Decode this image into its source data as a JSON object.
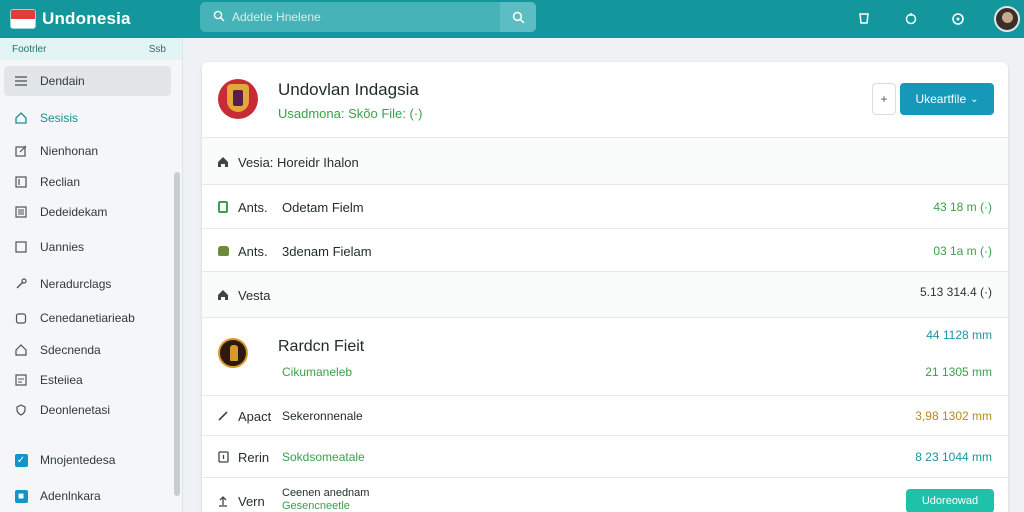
{
  "app": {
    "brand": "Undonesia",
    "search_placeholder": "Addetie Hnelene"
  },
  "colors": {
    "topbar": "#14979c",
    "accent_green": "#3aa04a",
    "accent_blue": "#1698b9",
    "chip": "#1ec2a8"
  },
  "topbar_icons": [
    "search-icon",
    "shield-icon",
    "bell-icon",
    "info-icon",
    "user-avatar"
  ],
  "sidebar": {
    "header_left": "Footrler",
    "header_right": "Ssb",
    "items": [
      {
        "label": "Dendain",
        "icon": "menu-icon"
      },
      {
        "label": "Sesisis",
        "icon": "home-icon"
      },
      {
        "label": "Nienhonan",
        "icon": "edit-icon"
      },
      {
        "label": "Reclian",
        "icon": "note-icon"
      },
      {
        "label": "Dedeidekam",
        "icon": "list-icon"
      },
      {
        "label": "Uannies",
        "icon": "square-icon"
      },
      {
        "label": "Neradurclags",
        "icon": "wrench-icon"
      },
      {
        "label": "Cenedanetiarieab",
        "icon": "clipboard-icon"
      },
      {
        "label": "Sdecnenda",
        "icon": "home-icon"
      },
      {
        "label": "Esteiiea",
        "icon": "doc-icon"
      },
      {
        "label": "Deonlenetasi",
        "icon": "shield-icon"
      },
      {
        "label": "Mnojentedesa",
        "icon": "checkbox-icon"
      },
      {
        "label": "Adenlnkara",
        "icon": "checkbox-icon"
      }
    ]
  },
  "main": {
    "title": "Undovlan Indagsia",
    "subtitle": "Usadmona: Skõo File: (·)",
    "small_button": "+",
    "primary_button": "Ukeartfile",
    "rows": [
      {
        "kind": "section",
        "icon": "home-icon",
        "text": "Vesia: Horeidr Ihalon"
      },
      {
        "kind": "file",
        "icon": "file-icon",
        "prefix": "Ants.",
        "name": "Odetam Fielm",
        "value": "43 18 m (·)"
      },
      {
        "kind": "file",
        "icon": "lock-icon",
        "prefix": "Ants.",
        "name": "3denam Fielam",
        "value": "03 1a m (·)"
      },
      {
        "kind": "section",
        "icon": "home-icon",
        "text": "Vesta",
        "value": "5.13 314.4 (·)"
      },
      {
        "kind": "feature",
        "title": "Rardcn Fieit",
        "subtitle": "Cikumaneleb",
        "value_top": "44 1128 mm",
        "value_bottom": "21 1305 mm"
      },
      {
        "kind": "file",
        "icon": "pencil-icon",
        "prefix": "Apact",
        "name": "Sekeronnenale",
        "value": "3,98 1302 mm"
      },
      {
        "kind": "file",
        "icon": "doc-icon",
        "prefix": "Rerin",
        "name": "Sokdsomeatale",
        "value": "8 23 1044 mm"
      },
      {
        "kind": "file",
        "icon": "upload-icon",
        "prefix": "Vern",
        "name_top": "Ceenen anednam",
        "name_bottom": "Gesencneetle",
        "chip": "Udoreowad"
      }
    ]
  }
}
